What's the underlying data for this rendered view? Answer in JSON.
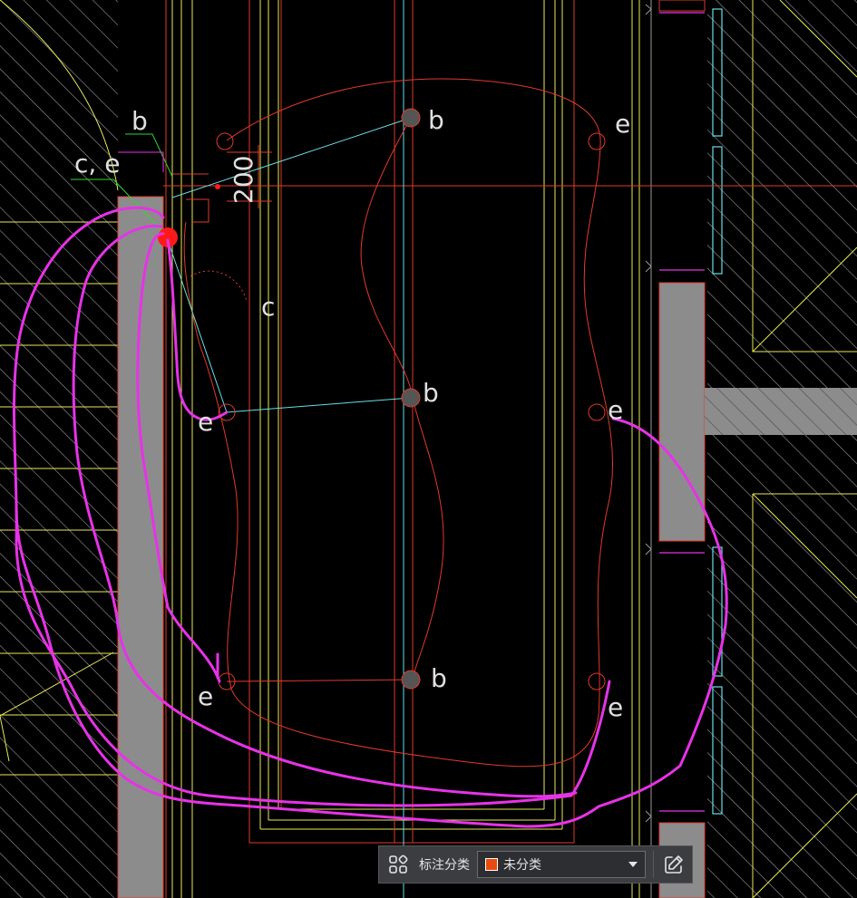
{
  "drawing": {
    "labels": {
      "b_top_left": "b",
      "ce": "c, e",
      "dimension": "200",
      "c_mid": "c",
      "b_top": "b",
      "e_top_right": "e",
      "b_mid": "b",
      "e_mid_left": "e",
      "e_mid_right": "e",
      "b_bottom": "b",
      "e_bottom_left": "e",
      "e_bottom_right": "e"
    },
    "colors": {
      "background": "#000000",
      "wall_fill": "#8c8c8c",
      "hatch": "#9a9a9a",
      "yellow_line": "#e8e85a",
      "red_line": "#e03a2a",
      "cyan_line": "#66e0e8",
      "magenta_markup": "#e633e6",
      "green_leader": "#33d633",
      "label_text": "#e0e0e0"
    }
  },
  "toolbar": {
    "group_icon": "grid-icon",
    "label": "标注分类",
    "selected": "未分类",
    "swatch_color": "#e84a10",
    "edit_icon": "edit-icon"
  }
}
